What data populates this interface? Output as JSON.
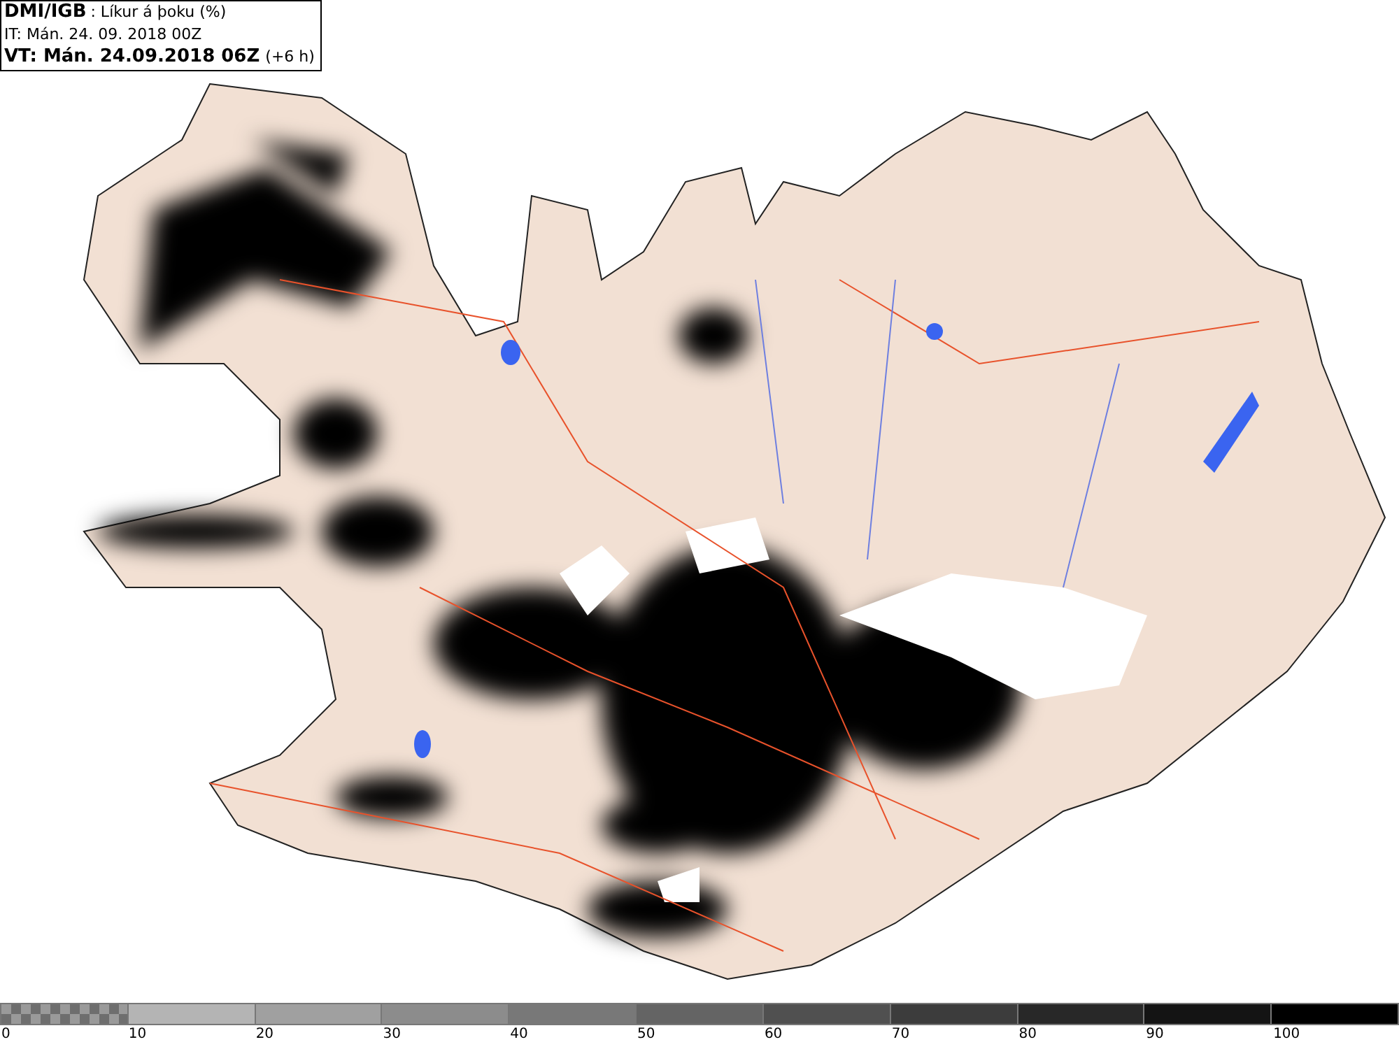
{
  "header": {
    "source": "DMI/IGB",
    "product": ": Líkur á þoku (%)",
    "issue_time": "IT: Mán. 24. 09. 2018 00Z",
    "valid_time": "VT: Mán. 24.09.2018 06Z",
    "valid_offset": "(+6 h)"
  },
  "legend": [
    {
      "label": "0",
      "kind": "checker",
      "color": "#6e6e6e"
    },
    {
      "label": "10",
      "kind": "solid",
      "color": "#b4b4b4"
    },
    {
      "label": "20",
      "kind": "solid",
      "color": "#a0a0a0"
    },
    {
      "label": "30",
      "kind": "solid",
      "color": "#8c8c8c"
    },
    {
      "label": "40",
      "kind": "solid",
      "color": "#787878"
    },
    {
      "label": "50",
      "kind": "solid",
      "color": "#646464"
    },
    {
      "label": "60",
      "kind": "solid",
      "color": "#505050"
    },
    {
      "label": "70",
      "kind": "solid",
      "color": "#3c3c3c"
    },
    {
      "label": "80",
      "kind": "solid",
      "color": "#282828"
    },
    {
      "label": "90",
      "kind": "solid",
      "color": "#141414"
    },
    {
      "label": "100",
      "kind": "solid",
      "color": "#000000"
    }
  ]
}
